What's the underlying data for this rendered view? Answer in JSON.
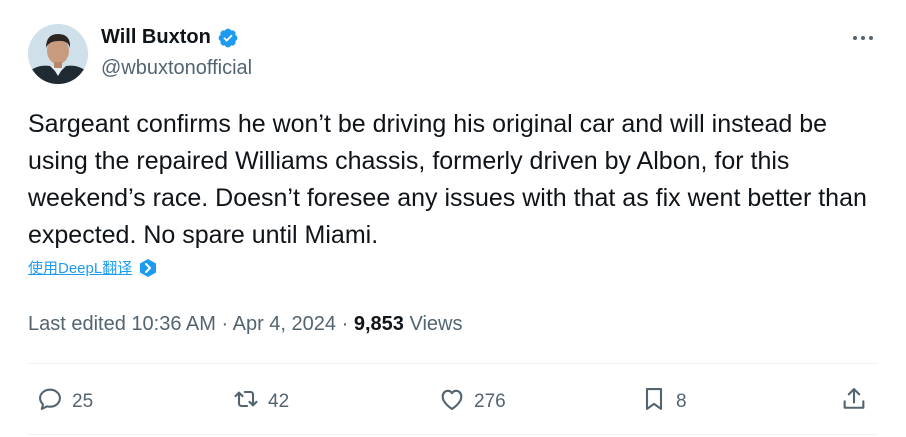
{
  "author": {
    "display_name": "Will Buxton",
    "handle": "@wbuxtonofficial",
    "verified": true
  },
  "tweet": {
    "text": "Sargeant confirms he won’t be driving his original car and will instead be using the repaired Williams chassis, formerly driven by Albon, for this weekend’s race. Doesn’t foresee any issues with that as fix went better than expected. No spare until Miami.",
    "translate_label": "使用DeepL翻译"
  },
  "meta": {
    "edited_prefix": "Last edited",
    "time": "10:36 AM",
    "separator": "·",
    "date": "Apr 4, 2024",
    "views_count": "9,853",
    "views_label": "Views"
  },
  "actions": {
    "replies": "25",
    "reposts": "42",
    "likes": "276",
    "bookmarks": "8"
  },
  "colors": {
    "accent": "#1d9bf0",
    "text": "#0f1419",
    "secondary": "#536471",
    "divider": "#eff3f4"
  },
  "icons": [
    "verified-badge-icon",
    "more-icon",
    "deepl-icon",
    "reply-icon",
    "repost-icon",
    "like-icon",
    "bookmark-icon",
    "share-icon"
  ]
}
